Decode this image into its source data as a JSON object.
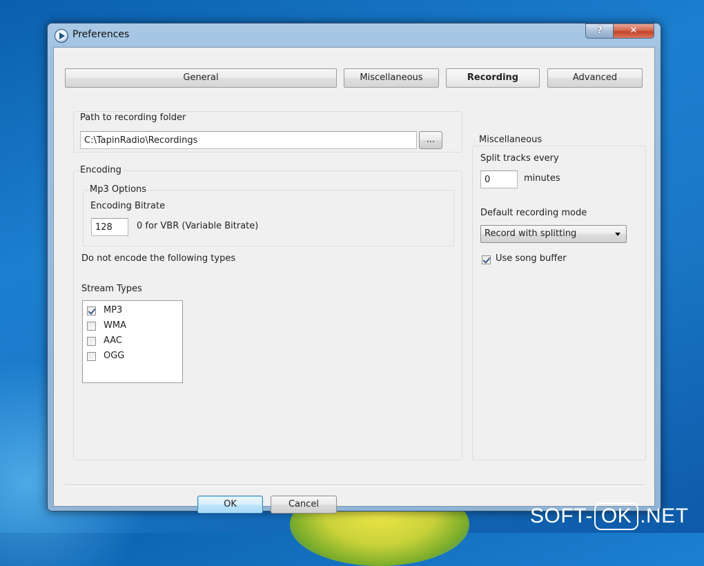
{
  "window": {
    "title": "Preferences",
    "help_button": "?",
    "close_button": "✕"
  },
  "tabs": [
    {
      "label": "General",
      "active": false
    },
    {
      "label": "Miscellaneous",
      "active": false
    },
    {
      "label": "Recording",
      "active": true
    },
    {
      "label": "Advanced",
      "active": false
    }
  ],
  "recording_folder": {
    "label": "Path to recording folder",
    "path_value": "C:\\TapinRadio\\Recordings",
    "browse_label": "..."
  },
  "encoding": {
    "group_label": "Encoding",
    "mp3_group_label": "Mp3 Options",
    "bitrate_label": "Encoding Bitrate",
    "bitrate_value": "128",
    "bitrate_hint": "0 for VBR (Variable Bitrate)",
    "exclude_label": "Do not encode the following types",
    "stream_types_label": "Stream Types",
    "stream_types": [
      {
        "label": "MP3",
        "checked": true
      },
      {
        "label": "WMA",
        "checked": false
      },
      {
        "label": "AAC",
        "checked": false
      },
      {
        "label": "OGG",
        "checked": false
      }
    ]
  },
  "misc": {
    "group_label": "Miscellaneous",
    "split_label": "Split tracks every",
    "split_value": "0",
    "split_unit": "minutes",
    "mode_label": "Default recording mode",
    "mode_value": "Record with splitting",
    "song_buffer_label": "Use song buffer",
    "song_buffer_checked": true
  },
  "footer": {
    "ok_label": "OK",
    "cancel_label": "Cancel"
  },
  "watermark": {
    "prefix": "SOFT-",
    "boxed": "OK",
    "suffix": ".NET"
  }
}
